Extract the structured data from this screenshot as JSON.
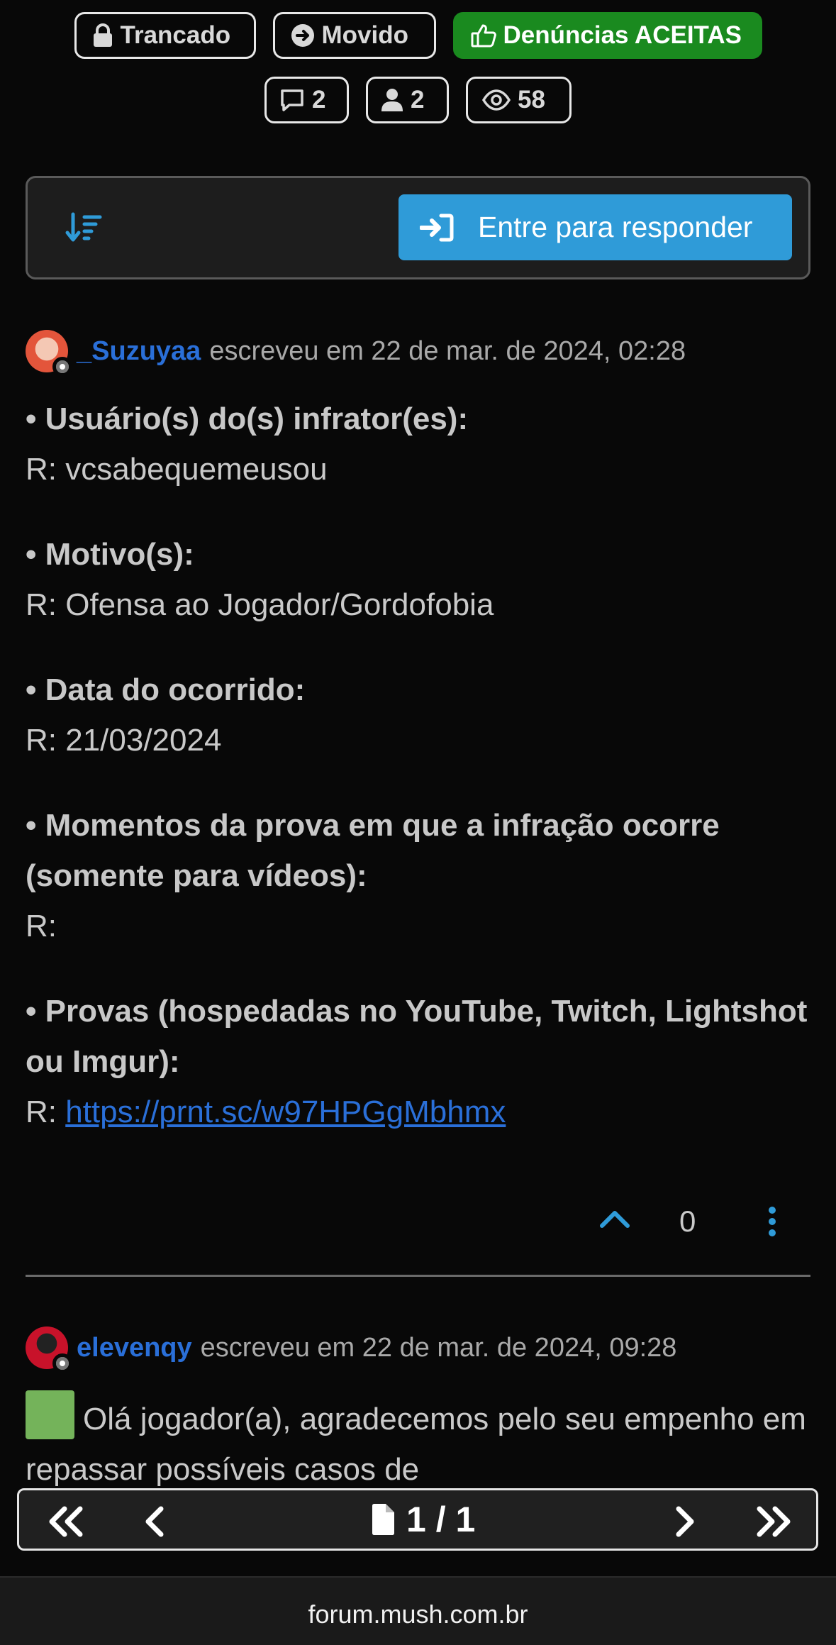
{
  "badges": {
    "locked": "Trancado",
    "moved": "Movido",
    "accepted": "Denúncias ACEITAS",
    "posts": "2",
    "posters": "2",
    "views": "58"
  },
  "toolbar": {
    "reply_label": "Entre para responder"
  },
  "post1": {
    "author": "_Suzuyaa",
    "meta": "escreveu em 22 de mar. de 2024, 02:28",
    "q1": "• Usuário(s) do(s) infrator(es):",
    "a1": "R: vcsabequemeusou",
    "q2": "• Motivo(s):",
    "a2": "R: Ofensa ao Jogador/Gordofobia",
    "q3": "• Data do ocorrido:",
    "a3": "R: 21/03/2024",
    "q4": "• Momentos da prova em que a infração ocorre (somente para vídeos):",
    "a4": "R:",
    "q5": "• Provas (hospedadas no YouTube, Twitch, Lightshot ou Imgur):",
    "a5_prefix": "R:",
    "a5_link": "https://prnt.sc/w97HPGgMbhmx",
    "votes": "0"
  },
  "post2": {
    "author": "elevenqy",
    "meta": "escreveu em 22 de mar. de 2024, 09:28",
    "text": "Olá jogador(a), agradecemos pelo seu empenho em repassar possíveis casos de"
  },
  "pagination": {
    "current": "1",
    "total": "1"
  },
  "browser": {
    "url": "forum.mush.com.br"
  },
  "colors": {
    "accent": "#2f9bd8",
    "accepted": "#1a8a1f",
    "author": "#2a6fd8",
    "background": "#080808"
  }
}
